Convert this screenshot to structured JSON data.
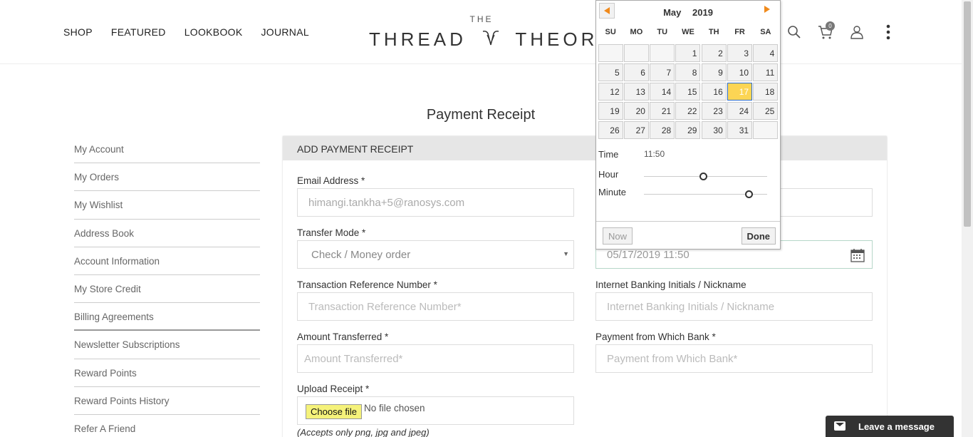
{
  "nav": {
    "items": [
      "SHOP",
      "FEATURED",
      "LOOKBOOK",
      "JOURNAL"
    ]
  },
  "logo": {
    "top": "THE",
    "left": "THREAD",
    "right": "THEORY"
  },
  "header": {
    "cart_count": "0",
    "icons": [
      "search-icon",
      "cart-icon",
      "user-icon",
      "more-vertical-icon"
    ]
  },
  "page": {
    "title": "Payment Receipt"
  },
  "sidebar": {
    "items": [
      {
        "label": "My Account"
      },
      {
        "label": "My Orders"
      },
      {
        "label": "My Wishlist"
      },
      {
        "label": "Address Book"
      },
      {
        "label": "Account Information"
      },
      {
        "label": "My Store Credit"
      },
      {
        "label": "Billing Agreements"
      },
      {
        "label": "Newsletter Subscriptions"
      },
      {
        "label": "Reward Points"
      },
      {
        "label": "Reward Points History"
      },
      {
        "label": "Refer A Friend"
      }
    ]
  },
  "form": {
    "heading": "ADD PAYMENT RECEIPT",
    "email_label": "Email Address *",
    "email_value": "himangi.tankha+5@ranosys.com",
    "transfer_label": "Transfer Mode *",
    "transfer_value": "Check / Money order",
    "date_value": "05/17/2019 11:50",
    "txn_label": "Transaction Reference Number *",
    "txn_placeholder": "Transaction Reference Number*",
    "ib_label": "Internet Banking Initials / Nickname",
    "ib_placeholder": "Internet Banking Initials / Nickname",
    "amount_label": "Amount Transferred *",
    "amount_placeholder": "Amount Transferred*",
    "bank_label": "Payment from Which Bank *",
    "bank_placeholder": "Payment from Which Bank*",
    "upload_label": "Upload Receipt *",
    "choose_file": "Choose file",
    "no_file": "No file chosen",
    "accept_note": "(Accepts only png, jpg and jpeg)"
  },
  "datepicker": {
    "month": "May",
    "year": "2019",
    "weekdays": [
      "SU",
      "MO",
      "TU",
      "WE",
      "TH",
      "FR",
      "SA"
    ],
    "weeks": [
      [
        "",
        "",
        "",
        "1",
        "2",
        "3",
        "4"
      ],
      [
        "5",
        "6",
        "7",
        "8",
        "9",
        "10",
        "11"
      ],
      [
        "12",
        "13",
        "14",
        "15",
        "16",
        "17",
        "18"
      ],
      [
        "19",
        "20",
        "21",
        "22",
        "23",
        "24",
        "25"
      ],
      [
        "26",
        "27",
        "28",
        "29",
        "30",
        "31",
        ""
      ]
    ],
    "selected_day": "17",
    "time_label": "Time",
    "time_value": "11:50",
    "hour_label": "Hour",
    "minute_label": "Minute",
    "hour_fraction": 0.48,
    "minute_fraction": 0.85,
    "now_label": "Now",
    "done_label": "Done"
  },
  "chat": {
    "label": "Leave a message"
  }
}
